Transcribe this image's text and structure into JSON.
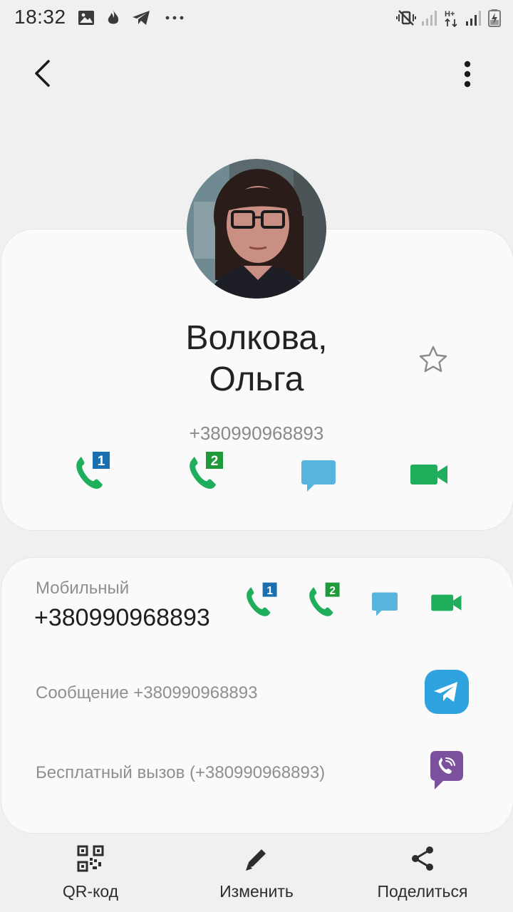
{
  "status_bar": {
    "time": "18:32",
    "left_icons": [
      "gallery-icon",
      "flame-icon",
      "telegram-icon",
      "more-dots-icon"
    ],
    "right_icons": [
      "mute-vibrate-icon",
      "signal-icon",
      "hplus-data-icon",
      "signal-icon",
      "battery-charging-icon"
    ]
  },
  "top_bar": {
    "back_icon": "chevron-left-icon",
    "menu_icon": "more-vertical-icon"
  },
  "contact": {
    "name_line1": "Волкова,",
    "name_line2": "Ольга",
    "phone": "+380990968893",
    "favorite_icon": "star-outline-icon"
  },
  "quick_actions": [
    {
      "name": "call-sim1-button",
      "icon": "phone-sim1-icon",
      "sim": "1"
    },
    {
      "name": "call-sim2-button",
      "icon": "phone-sim2-icon",
      "sim": "2"
    },
    {
      "name": "message-button",
      "icon": "message-icon"
    },
    {
      "name": "video-call-button",
      "icon": "video-icon"
    }
  ],
  "mobile": {
    "label": "Мобильный",
    "number": "+380990968893"
  },
  "rows": [
    {
      "text": "Сообщение +380990968893",
      "icon": "telegram-app-icon"
    },
    {
      "text": "Бесплатный вызов (+380990968893)",
      "icon": "viber-app-icon"
    }
  ],
  "bottom_bar": {
    "qr_label": "QR-код",
    "edit_label": "Изменить",
    "share_label": "Поделиться"
  },
  "colors": {
    "call_green": "#1fae5c",
    "sim1_blue": "#1a6fb0",
    "sim2_green": "#1e9a3a",
    "message_blue": "#56b4de",
    "telegram_blue": "#2fa3e0",
    "viber_purple": "#7b519d"
  }
}
